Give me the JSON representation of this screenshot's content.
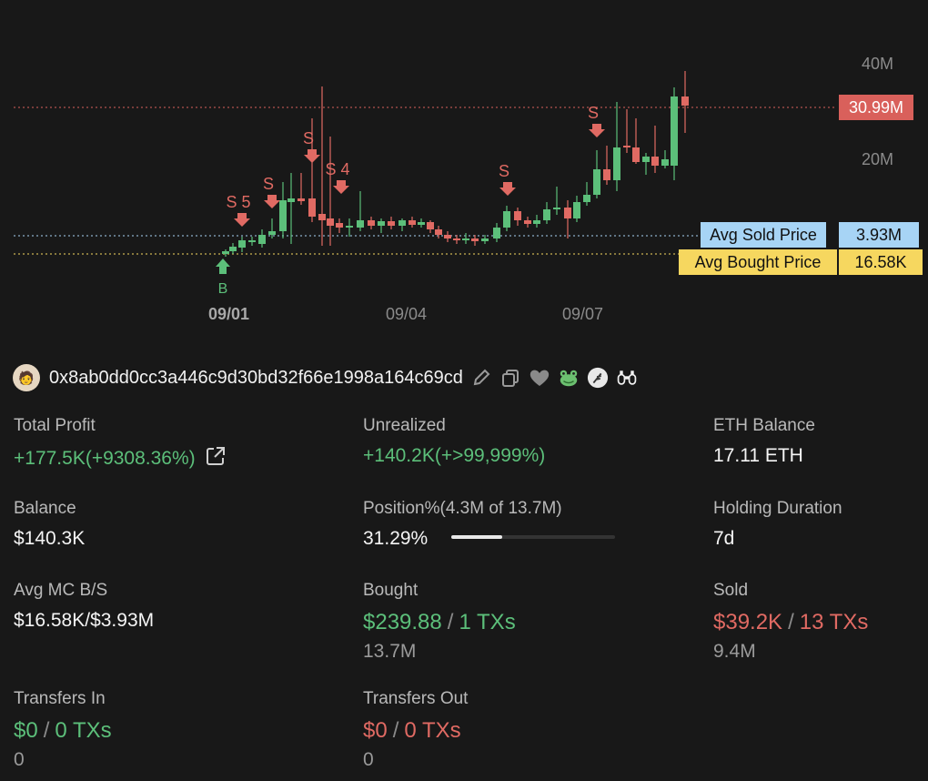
{
  "chart": {
    "y_ticks": [
      "40M",
      "20M"
    ],
    "x_ticks": [
      "09/01",
      "09/04",
      "09/07"
    ],
    "current_price": "30.99M",
    "avg_sold_label": "Avg Sold Price",
    "avg_sold_value": "3.93M",
    "avg_bought_label": "Avg Bought Price",
    "avg_bought_value": "16.58K",
    "colors": {
      "up": "#5cbf7a",
      "down": "#e06a63"
    },
    "markers": [
      "S5",
      "S",
      "S",
      "S4",
      "S",
      "S",
      "B"
    ]
  },
  "wallet": {
    "address": "0x8ab0dd0cc3a446c9d30bd32f66e1998a164c69cd",
    "icons": [
      "edit-icon",
      "copy-icon",
      "heart-icon",
      "frog-icon",
      "feather-icon",
      "binoculars-icon"
    ]
  },
  "stats": {
    "total_profit": {
      "label": "Total Profit",
      "value": "+177.5K(+9308.36%)"
    },
    "unrealized": {
      "label": "Unrealized",
      "value": "+140.2K(+>99,999%)"
    },
    "eth_balance": {
      "label": "ETH Balance",
      "value": "17.11 ETH"
    },
    "balance": {
      "label": "Balance",
      "value": "$140.3K"
    },
    "position": {
      "label": "Position%(4.3M of 13.7M)",
      "value": "31.29%",
      "fill": 0.3129
    },
    "holding": {
      "label": "Holding Duration",
      "value": "7d"
    },
    "avg_mc": {
      "label": "Avg MC B/S",
      "value": "$16.58K/$3.93M"
    },
    "bought": {
      "label": "Bought",
      "amount": "$239.88",
      "txs": "1 TXs",
      "sub": "13.7M"
    },
    "sold": {
      "label": "Sold",
      "amount": "$39.2K",
      "txs": "13 TXs",
      "sub": "9.4M"
    },
    "transfers_in": {
      "label": "Transfers In",
      "amount": "$0",
      "txs": "0 TXs",
      "sub": "0"
    },
    "transfers_out": {
      "label": "Transfers Out",
      "amount": "$0",
      "txs": "0 TXs",
      "sub": "0"
    },
    "slash": "/"
  }
}
